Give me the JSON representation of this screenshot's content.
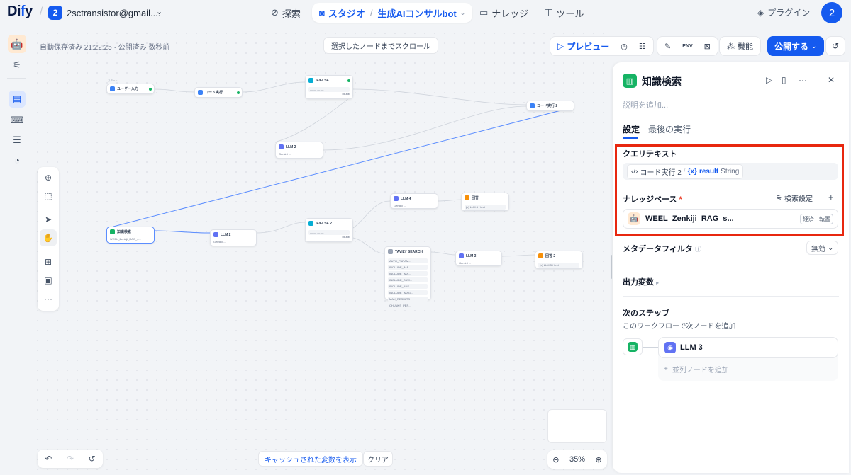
{
  "app": {
    "logo_d": "Di",
    "logo_y": "f",
    "logo_rest": "y"
  },
  "workspace": {
    "avatar": "2",
    "name": "2sctransistor@gmail...."
  },
  "nav": {
    "explore": "探索",
    "studio": "スタジオ",
    "app_name": "生成AIコンサルbot",
    "knowledge": "ナレッジ",
    "tools": "ツール"
  },
  "plugin_label": "プラグイン",
  "user_avatar": "2",
  "canvas": {
    "autosave": "自動保存済み 21:22:25 · 公開済み 数秒前",
    "scroll_to_node": "選択したノードまでスクロール",
    "preview": "プレビュー",
    "features": "機能",
    "publish": "公開する",
    "env_label": "ENV",
    "show_cached": "キャッシュされた変数を表示",
    "clear": "クリア",
    "zoom": "35%"
  },
  "nodes": {
    "start_tag": "スタート",
    "user_input": "ユーザー入力",
    "code1": "コード実行",
    "ifelse": "IF/ELSE",
    "ifelse_else": "ELSE",
    "code2": "コード実行 2",
    "llm2": "LLM 2",
    "llm2_model": "Gemini ...",
    "kb": "知識検索",
    "kb_sub": "WEEL_Zenkiji_RAG_s...",
    "llm": "LLM 2",
    "llm_model": "Gemini ...",
    "ifelse2": "IF/ELSE 2",
    "ifelse2_else": "ELSE",
    "llm4": "LLM 4",
    "llm4_model": "Gemini ...",
    "answer": "回答",
    "answer_sub": "{x} LLM 4 / text",
    "tavily": "TAVILY SEARCH",
    "tavily_rows": [
      "AUTO_PARAM...",
      "INCLUDE_IMA...",
      "INCLUDE_IMA...",
      "INCLUDE_RAW...",
      "INCLUDE_ANS...",
      "INCLUDE_IMAG...",
      "MAX_RESULTS",
      "CHUNKS_PER..."
    ],
    "llm3": "LLM 3",
    "llm3_model": "Gemini ...",
    "answer2": "回答 2",
    "answer2_sub": "{x} LLM 3 / text"
  },
  "panel": {
    "title": "知識検索",
    "desc_placeholder": "説明を追加...",
    "tab_settings": "設定",
    "tab_last_run": "最後の実行",
    "query_label": "クエリテキスト",
    "query_node": "コード実行 2",
    "query_var_prefix": "{x}",
    "query_var": "result",
    "query_type": "String",
    "kb_label": "ナレッジベース",
    "kb_required": "*",
    "retrieval_settings": "検索設定",
    "kb_item_name": "WEEL_Zenkiji_RAG_s...",
    "kb_item_badge": "経済 · 転置",
    "metadata_label": "メタデータフィルタ",
    "metadata_value": "無効",
    "output_vars": "出力変数",
    "next_step": "次のステップ",
    "next_step_desc": "このワークフローで次ノードを追加",
    "next_node": "LLM 3",
    "add_parallel": "並列ノードを追加"
  }
}
